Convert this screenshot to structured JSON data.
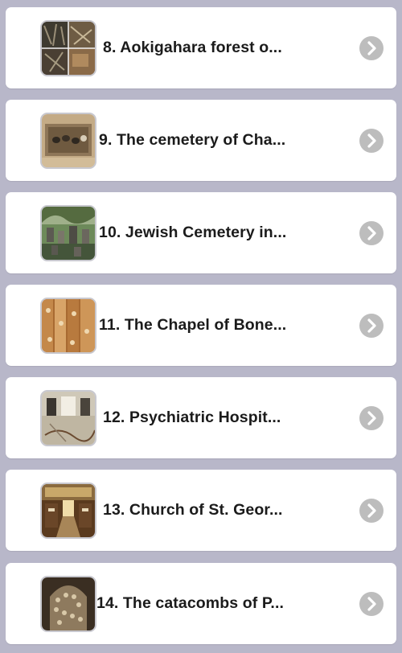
{
  "colors": {
    "background": "#b8b7c9",
    "card": "#ffffff",
    "chevron_circle": "#bdbdbd",
    "text": "#1b1b1b"
  },
  "items": [
    {
      "title": "8. Aokigahara forest o...",
      "thumbnail": "forest-collage-photo",
      "chevron": "chevron-right-icon"
    },
    {
      "title": "9. The cemetery of Cha...",
      "thumbnail": "mummies-pit-photo",
      "chevron": "chevron-right-icon"
    },
    {
      "title": "10. Jewish Cemetery in...",
      "thumbnail": "tombstones-photo",
      "chevron": "chevron-right-icon"
    },
    {
      "title": "11. The Chapel of Bone...",
      "thumbnail": "bone-wall-photo",
      "chevron": "chevron-right-icon"
    },
    {
      "title": "12. Psychiatric Hospit...",
      "thumbnail": "abandoned-hall-photo",
      "chevron": "chevron-right-icon"
    },
    {
      "title": "13. Church of St. Geor...",
      "thumbnail": "church-interior-photo",
      "chevron": "chevron-right-icon"
    },
    {
      "title": "14. The catacombs of P...",
      "thumbnail": "catacomb-skulls-photo",
      "chevron": "chevron-right-icon"
    }
  ]
}
